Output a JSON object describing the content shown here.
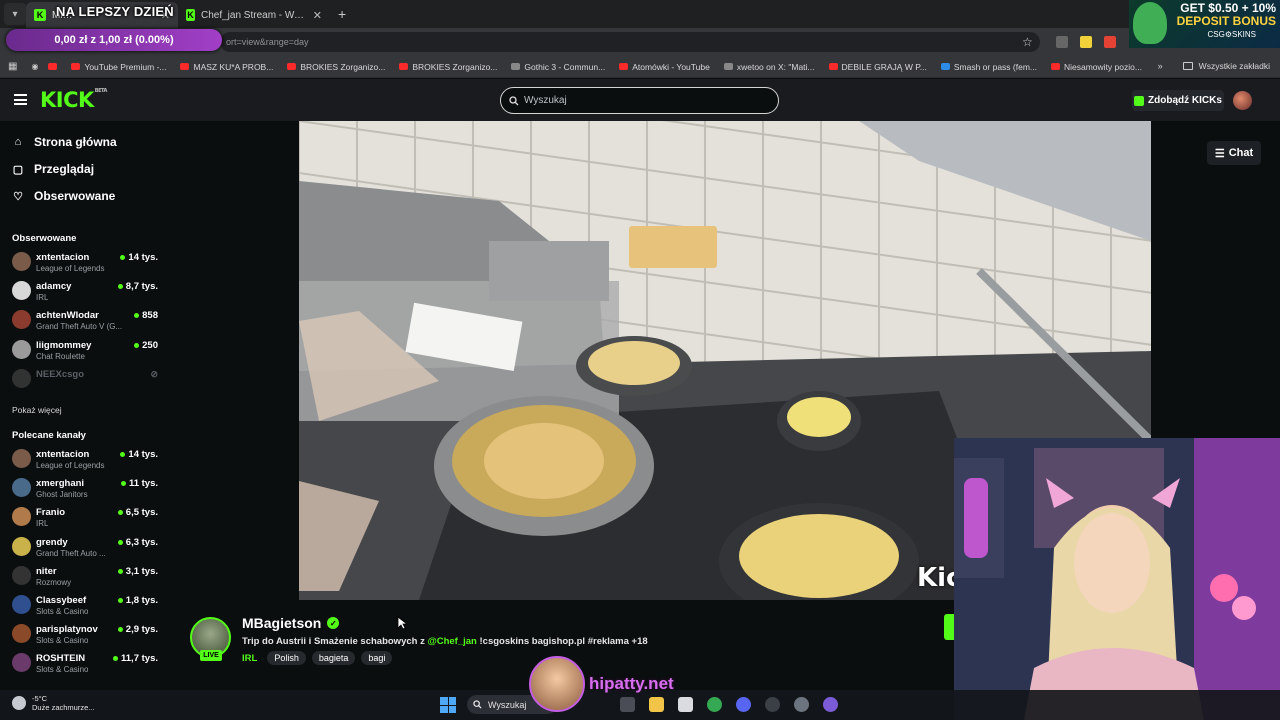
{
  "browser": {
    "tabs": [
      {
        "label": "Mi…",
        "favicon": "kick-favicon"
      },
      {
        "label": "Chef_jan Stream - Watch Live o",
        "favicon": "kick-favicon"
      }
    ],
    "new_tab": "+",
    "url": "ort=view&range=day",
    "promo_overlay": "NA LEPSZY DZIEŃ",
    "donation_bar": "0,00 zł z 1,00 zł (0.00%)",
    "bookmarks": [
      "YouTube Premium -...",
      "MASZ KU*A PROB...",
      "BROKIES Zorganizo...",
      "BROKIES Zorganizo...",
      "Gothic 3 - Commun...",
      "Atomówki - YouTube",
      "xwetoo on X: \"Mati...",
      "DEBILE GRAJĄ W P...",
      "Smash or pass (fem...",
      "Niesamowity pozio..."
    ],
    "all_bookmarks": "Wszystkie zakładki",
    "ad": {
      "line1": "GET $0.50 + 10%",
      "line2": "DEPOSIT BONUS",
      "brand": "CSG⚙SKINS"
    }
  },
  "kick": {
    "logo": "KICK",
    "logo_badge": "BETA",
    "search_placeholder": "Wyszukaj",
    "get_kicks": "Zdobądź KICKs",
    "chat_button": "Chat",
    "nav": [
      "Strona główna",
      "Przeglądaj",
      "Obserwowane"
    ],
    "followed_title": "Obserwowane",
    "followed": [
      {
        "name": "xntentacion",
        "category": "League of Legends",
        "viewers": "14 tys.",
        "color": "#7a5b4a"
      },
      {
        "name": "adamcy",
        "category": "IRL",
        "viewers": "8,7 tys.",
        "color": "#d8d8d8"
      },
      {
        "name": "achtenWlodar",
        "category": "Grand Theft Auto V (G...",
        "viewers": "858",
        "color": "#8a3b2e"
      },
      {
        "name": "liigmommey",
        "category": "Chat Roulette",
        "viewers": "250",
        "color": "#9a9a9a"
      },
      {
        "name": "NEEXcsgo",
        "category": "",
        "viewers": "",
        "color": "#777"
      }
    ],
    "show_more": "Pokaż więcej",
    "recommended_title": "Polecane kanały",
    "recommended": [
      {
        "name": "xntentacion",
        "category": "League of Legends",
        "viewers": "14 tys.",
        "color": "#7a5b4a"
      },
      {
        "name": "xmerghani",
        "category": "Ghost Janitors",
        "viewers": "11 tys.",
        "color": "#4a6a8a"
      },
      {
        "name": "Franio",
        "category": "IRL",
        "viewers": "6,5 tys.",
        "color": "#b07a4a"
      },
      {
        "name": "grendy",
        "category": "Grand Theft Auto ...",
        "viewers": "6,3 tys.",
        "color": "#c9b24a"
      },
      {
        "name": "niter",
        "category": "Rozmowy",
        "viewers": "3,1 tys.",
        "color": "#333"
      },
      {
        "name": "Classybeef",
        "category": "Slots & Casino",
        "viewers": "1,8 tys.",
        "color": "#2f4f8f"
      },
      {
        "name": "parisplatynov",
        "category": "Slots & Casino",
        "viewers": "2,9 tys.",
        "color": "#8a4a2a"
      },
      {
        "name": "ROSHTEIN",
        "category": "Slots & Casino",
        "viewers": "11,7 tys.",
        "color": "#6a3a6a"
      }
    ],
    "stream": {
      "streamer": "MBagietson",
      "live": "LIVE",
      "title_pre": "Trip do Austrii  i Smażenie schabowych z ",
      "title_mention": "@Chef_jan",
      "title_post": " !csgoskins bagishop.pl #reklama +18",
      "category": "IRL",
      "tags": [
        "Polish",
        "bagieta",
        "bagi"
      ],
      "watermark": "Kic"
    }
  },
  "taskbar": {
    "weather_temp": "-5°C",
    "weather_desc": "Duże zachmurze...",
    "search": "Wyszukaj",
    "overlay_site": "hipatty.net"
  }
}
